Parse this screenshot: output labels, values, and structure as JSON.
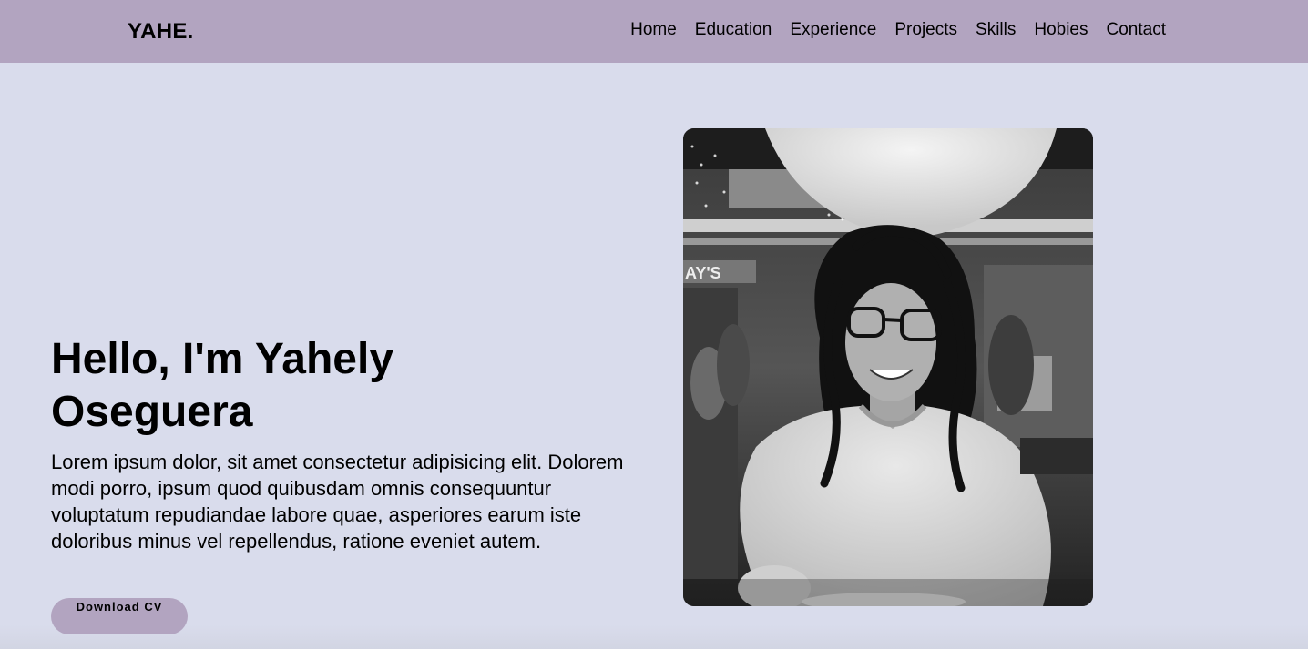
{
  "brand": {
    "logo": "YAHE."
  },
  "nav": {
    "links": [
      "Home",
      "Education",
      "Experience",
      "Projects",
      "Skills",
      "Hobies",
      "Contact"
    ]
  },
  "hero": {
    "title": "Hello, I'm Yahely Oseguera",
    "text": "Lorem ipsum dolor, sit amet consectetur adipisicing elit. Dolorem modi porro, ipsum quod quibusdam omnis consequuntur voluptatum repudiandae labore quae, asperiores earum iste doloribus minus vel repellendus, ratione eveniet autem.",
    "button_label": "Download CV"
  },
  "colors": {
    "navbar": "#b2a4c0",
    "background": "#d9dcec",
    "button": "#b2a4c0"
  }
}
